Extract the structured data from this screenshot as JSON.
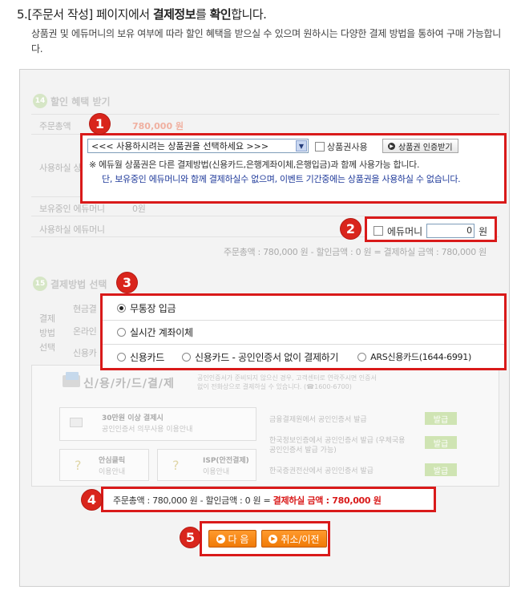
{
  "header": {
    "step_no": "5.",
    "title_pre": "[주문서 작성] 페이지에서 ",
    "title_bold1": "결제정보",
    "title_mid": "를 ",
    "title_bold2": "확인",
    "title_post": "합니다.",
    "description": "상품권 및 에듀머니의 보유 여부에 따라 할인 혜택을 받으실 수 있으며 원하시는 다양한 결제 방법을 통하여 구매 가능합니다."
  },
  "callout_numbers": [
    "1",
    "2",
    "3",
    "4",
    "5"
  ],
  "discount": {
    "section_no": "14",
    "section_title": "할인 혜택 받기",
    "order_total_label": "주문총액",
    "order_total_value": "780,000 원",
    "usable_label": "사용하실 상품권",
    "owned_money_label": "보유중인 에듀머니",
    "owned_money_value": "0원",
    "use_money_label": "사용하실 에듀머니",
    "voucher_select": "<<< 사용하시려는 상품권을 선택하세요 >>>",
    "voucher_use_label": "상품권사용",
    "voucher_auth_button": "상품권 인증받기",
    "note_line1": "※ 에듀월 상품권은 다른 결제방법(신용카드,은행계좌이체,은행입금)과 함께 사용가능 합니다.",
    "note_line2": "단, 보유중인 에듀머니와 함께 결제하실수 없으며, 이벤트 기간중에는 상품권을 사용하실 수 없습니다.",
    "edumoney_label": "에듀머니",
    "edumoney_value": "0",
    "edumoney_unit": "원",
    "summary_faded": "주문총액 : 780,000 원 - 할인금액 : 0 원 = 결제하실 금액 : 780,000 원"
  },
  "payment": {
    "section_no": "15",
    "section_title": "결제방법 선택",
    "side_label_1": "결제",
    "side_label_2": "방법",
    "side_label_3": "선택",
    "ghost_cash": "현금결",
    "ghost_online": "온라인",
    "ghost_card": "신용카",
    "options": {
      "bank_deposit": "무통장 입금",
      "realtime_transfer": "실시간 계좌이체",
      "credit_card": "신용카드",
      "card_no_cert": "신용카드 - 공인인증서 없이 결제하기",
      "ars_card": "ARS신용카드(1644-6991)"
    },
    "selected": "bank_deposit"
  },
  "card_banner": {
    "title": "신/용/카/드/결/제",
    "desc": "공인인증서가 준비되지 않으신 경우, 고객센터로 연락주시면 인증서 없이 전화상으로 결제하실 수 있습니다. (☎1600-6700)",
    "over300_title": "30만원 이상 결제시",
    "over300_sub": "공인인증서 의무사용 이용안내",
    "safe_click_title": "안심클릭",
    "safe_click_sub": "이용안내",
    "isp_title": "ISP(안전결제)",
    "isp_sub": "이용안내",
    "cert1": "금융결제원에서 공인인증서 발급",
    "cert2": "한국정보인증에서 공인인증서 발급 (우체국용 공인인증서 발급 가능)",
    "cert3": "한국증권전산에서 공인인증서 발급",
    "issue_button": "발급"
  },
  "summary": {
    "order_total": "주문총액 : 780,000 원",
    "discount": " - 할인금액 : 0 원 = ",
    "final_label": "결제하실 금액 : 780,000 원"
  },
  "actions": {
    "next": "다 음",
    "cancel": "취소/이전"
  },
  "colors": {
    "callout_red": "#d91a1a",
    "button_orange": "#f07a06",
    "note_blue": "#1f3a9a",
    "price_red": "#d91a1a"
  }
}
